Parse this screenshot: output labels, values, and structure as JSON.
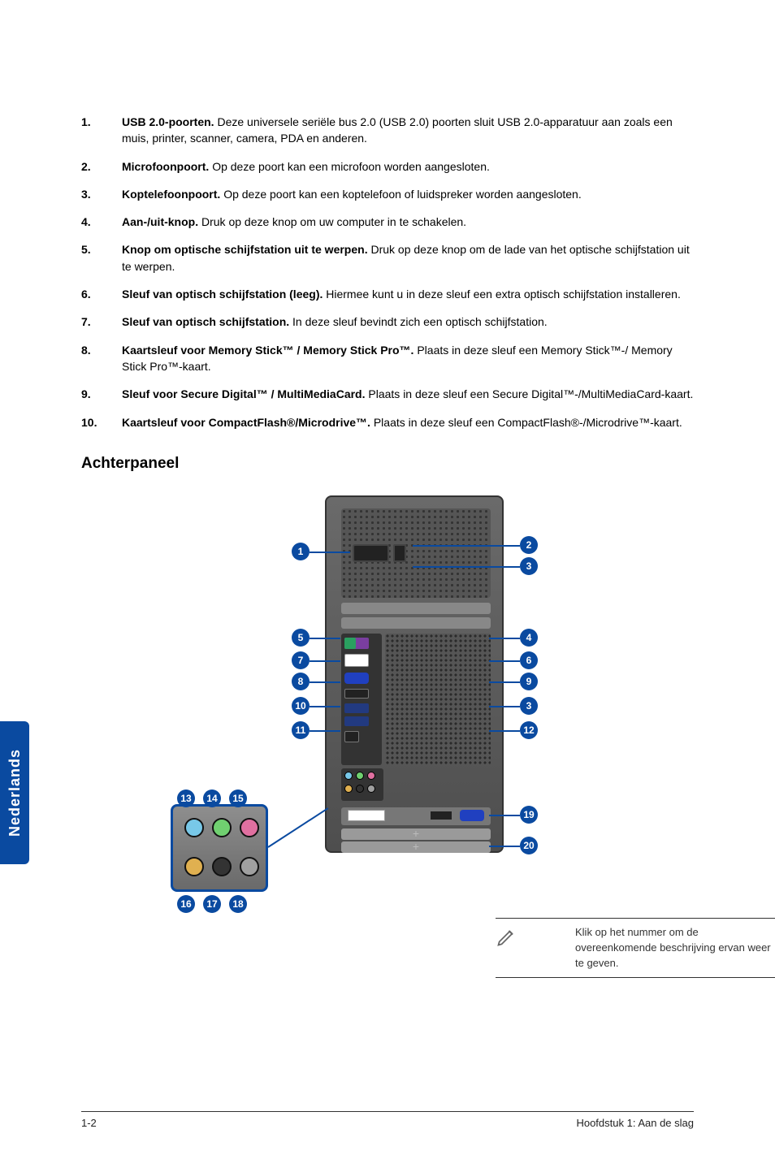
{
  "features": [
    {
      "num": "1.",
      "title": "USB 2.0-poorten.",
      "desc": " Deze universele seriële bus 2.0 (USB 2.0) poorten sluit USB 2.0-apparatuur aan zoals een muis, printer, scanner, camera, PDA en anderen."
    },
    {
      "num": "2.",
      "title": "Microfoonpoort.",
      "desc": " Op deze poort kan een microfoon worden aangesloten."
    },
    {
      "num": "3.",
      "title": "Koptelefoonpoort.",
      "desc": " Op deze poort kan een koptelefoon of luidspreker worden aangesloten."
    },
    {
      "num": "4.",
      "title": "Aan-/uit-knop.",
      "desc": " Druk op deze knop om uw computer in te schakelen."
    },
    {
      "num": "5.",
      "title": "Knop om optische schijfstation uit te werpen.",
      "desc": " Druk op deze knop om de lade van het optische schijfstation uit te werpen."
    },
    {
      "num": "6.",
      "title": "Sleuf van optisch schijfstation (leeg).",
      "desc": " Hiermee kunt u in deze sleuf een extra optisch schijfstation installeren."
    },
    {
      "num": "7.",
      "title": "Sleuf van optisch schijfstation.",
      "desc": " In deze sleuf bevindt zich een optisch schijfstation."
    },
    {
      "num": "8.",
      "title": "Kaartsleuf voor Memory Stick™ / Memory Stick Pro™.",
      "desc": " Plaats in deze sleuf een Memory Stick™-/ Memory Stick Pro™-kaart."
    },
    {
      "num": "9.",
      "title": "Sleuf voor Secure Digital™ / MultiMediaCard.",
      "desc": " Plaats in deze sleuf een Secure Digital™-/MultiMediaCard-kaart."
    },
    {
      "num": "10.",
      "title": "Kaartsleuf voor CompactFlash®/Microdrive™.",
      "desc": " Plaats in deze sleuf een CompactFlash®-/Microdrive™-kaart."
    }
  ],
  "section_heading": "Achterpaneel",
  "callouts": {
    "c1": "1",
    "c2": "2",
    "c3": "3",
    "c4": "4",
    "c5": "5",
    "c6": "6",
    "c7": "7",
    "c8": "8",
    "c9": "9",
    "c10": "10",
    "c11": "11",
    "c12": "12",
    "c13": "13",
    "c14": "14",
    "c15": "15",
    "c16": "16",
    "c17": "17",
    "c18": "18",
    "c19": "19",
    "c20": "20"
  },
  "note": "Klik op het nummer om de overeenkomende beschrijving ervan weer te geven.",
  "sidebar_label": "Nederlands",
  "footer_left": "1-2",
  "footer_right": "Hoofdstuk 1: Aan de slag"
}
